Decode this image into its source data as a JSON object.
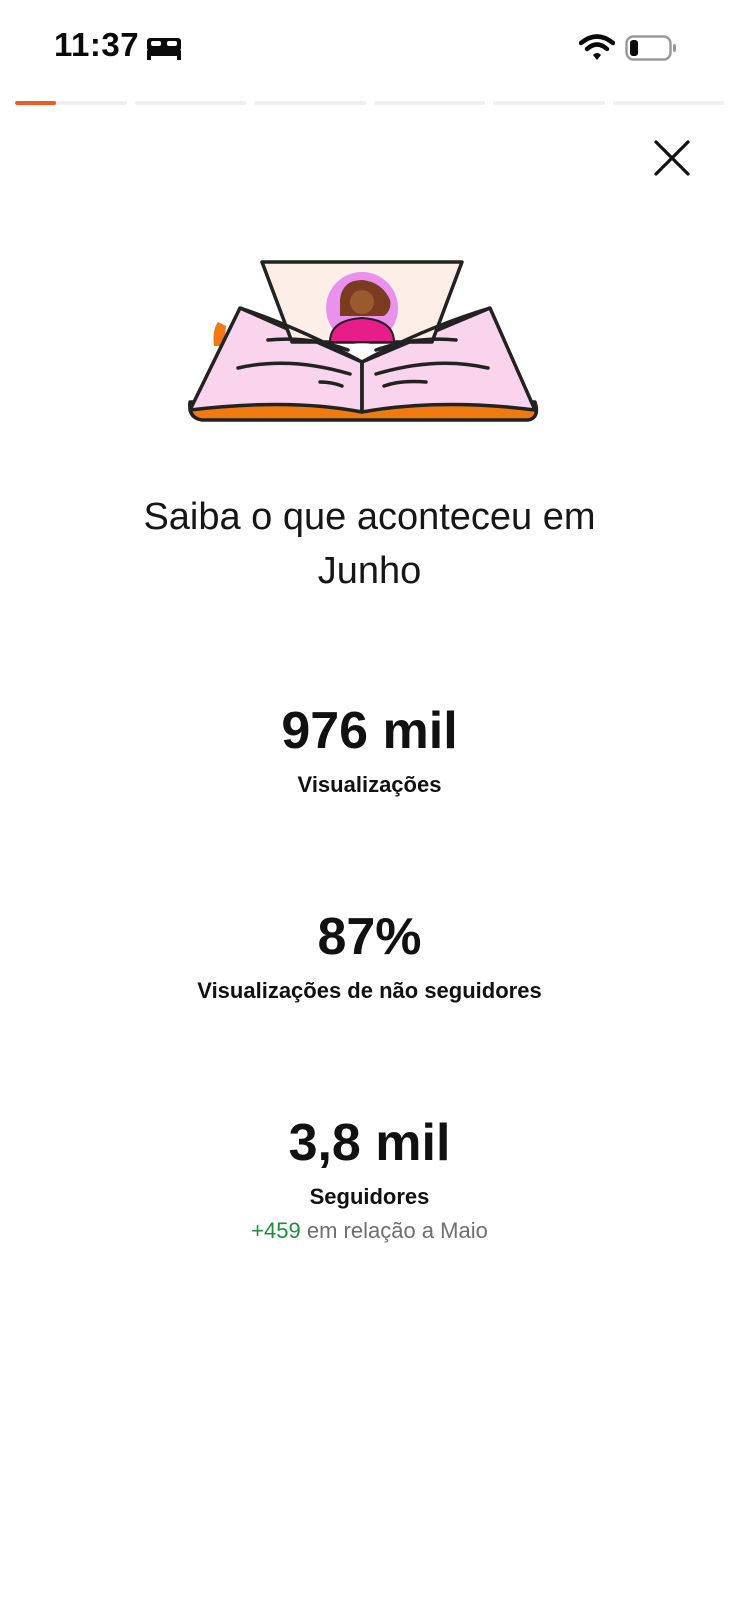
{
  "status_bar": {
    "time": "11:37"
  },
  "progress": {
    "segments": 6,
    "active_fill": 0.37,
    "accent_color": "#f15a24"
  },
  "icons": {
    "bed": "bed-icon",
    "wifi": "wifi-icon",
    "battery": "battery-icon",
    "close": "close-icon",
    "illustration": "open-book-illustration"
  },
  "headline": {
    "line1": "Saiba o que aconteceu em",
    "line2": "Junho"
  },
  "stats": [
    {
      "value": "976 mil",
      "label": "Visualizações"
    },
    {
      "value": "87%",
      "label": "Visualizações de não seguidores"
    },
    {
      "value": "3,8 mil",
      "label": "Seguidores",
      "delta_value": "+459",
      "delta_text": "em relação a Maio"
    }
  ]
}
